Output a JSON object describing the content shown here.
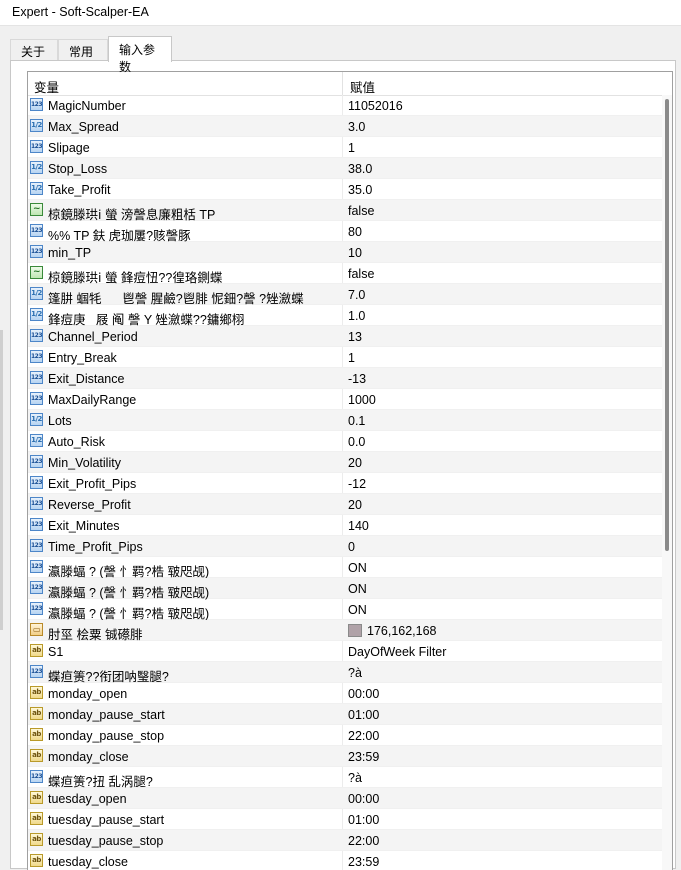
{
  "window": {
    "title": "Expert - Soft-Scalper-EA"
  },
  "tabs": [
    {
      "label": "关于"
    },
    {
      "label": "常用"
    },
    {
      "label": "输入参数"
    }
  ],
  "table": {
    "col_variable": "变量",
    "col_value": "赋值",
    "rows": [
      {
        "type": "int",
        "icon": "123",
        "name": "MagicNumber",
        "value": "11052016"
      },
      {
        "type": "double",
        "icon": "1/2",
        "name": "Max_Spread",
        "value": "3.0"
      },
      {
        "type": "int",
        "icon": "123",
        "name": "Slipage",
        "value": "1"
      },
      {
        "type": "double",
        "icon": "1/2",
        "name": "Stop_Loss",
        "value": "38.0"
      },
      {
        "type": "double",
        "icon": "1/2",
        "name": "Take_Profit",
        "value": "35.0"
      },
      {
        "type": "bool",
        "icon": "~",
        "name": "椋鏡滕珙ⅰ 螢 滂謦息廉粗栝 TP",
        "value": "false"
      },
      {
        "type": "int",
        "icon": "123",
        "name": "%% TP 鈇 虎珈屢?赅謦豚",
        "value": "80"
      },
      {
        "type": "int",
        "icon": "123",
        "name": "min_TP",
        "value": "10"
      },
      {
        "type": "bool",
        "icon": "~",
        "name": "椋鏡滕珙ⅰ 螢 鋒痘忸??徨珞鍘蝶",
        "value": "false"
      },
      {
        "type": "double",
        "icon": "1/2",
        "name": "篷肼 蝈牦      鬯謦 腥鹼?鬯腓 怩鈿?謦 ?矬瀲蝶",
        "value": "7.0"
      },
      {
        "type": "double",
        "icon": "1/2",
        "name": "鋒痘庚   屐 阄 謦 Y 矬瀲蝶??鏞鄉栩",
        "value": "1.0"
      },
      {
        "type": "int",
        "icon": "123",
        "name": "Channel_Period",
        "value": "13"
      },
      {
        "type": "int",
        "icon": "123",
        "name": "Entry_Break",
        "value": "1"
      },
      {
        "type": "int",
        "icon": "123",
        "name": "Exit_Distance",
        "value": "-13"
      },
      {
        "type": "int",
        "icon": "123",
        "name": "MaxDailyRange",
        "value": "1000"
      },
      {
        "type": "double",
        "icon": "1/2",
        "name": "Lots",
        "value": "0.1"
      },
      {
        "type": "double",
        "icon": "1/2",
        "name": "Auto_Risk",
        "value": "0.0"
      },
      {
        "type": "int",
        "icon": "123",
        "name": "Min_Volatility",
        "value": "20"
      },
      {
        "type": "int",
        "icon": "123",
        "name": "Exit_Profit_Pips",
        "value": "-12"
      },
      {
        "type": "int",
        "icon": "123",
        "name": "Reverse_Profit",
        "value": "20"
      },
      {
        "type": "int",
        "icon": "123",
        "name": "Exit_Minutes",
        "value": "140"
      },
      {
        "type": "int",
        "icon": "123",
        "name": "Time_Profit_Pips",
        "value": "0"
      },
      {
        "type": "int",
        "icon": "123",
        "name": "瀛滕蝠 ? (謦 忄羁?梏 皲咫觇)",
        "value": "ON"
      },
      {
        "type": "int",
        "icon": "123",
        "name": "瀛滕蝠 ? (謦 忄羁?梏 皲咫觇)",
        "value": "ON"
      },
      {
        "type": "int",
        "icon": "123",
        "name": "瀛滕蝠 ? (謦 忄羁?梏 皲咫觇)",
        "value": "ON"
      },
      {
        "type": "color",
        "icon": "▭",
        "name": "肘巠 桧粟 铖礤腓",
        "value": "176,162,168",
        "swatch": "#b0a2a8"
      },
      {
        "type": "string",
        "icon": "ab",
        "name": "S1",
        "value": "DayOfWeek Filter"
      },
      {
        "type": "int",
        "icon": "123",
        "name": "蝶疸箦??衔团呐瑿腿?",
        "value": "?à"
      },
      {
        "type": "string",
        "icon": "ab",
        "name": "monday_open",
        "value": "00:00"
      },
      {
        "type": "string",
        "icon": "ab",
        "name": "monday_pause_start",
        "value": "01:00"
      },
      {
        "type": "string",
        "icon": "ab",
        "name": "monday_pause_stop",
        "value": "22:00"
      },
      {
        "type": "string",
        "icon": "ab",
        "name": "monday_close",
        "value": "23:59"
      },
      {
        "type": "int",
        "icon": "123",
        "name": "蝶疸箦?扭 乱涡腿?",
        "value": "?à"
      },
      {
        "type": "string",
        "icon": "ab",
        "name": "tuesday_open",
        "value": "00:00"
      },
      {
        "type": "string",
        "icon": "ab",
        "name": "tuesday_pause_start",
        "value": "01:00"
      },
      {
        "type": "string",
        "icon": "ab",
        "name": "tuesday_pause_stop",
        "value": "22:00"
      },
      {
        "type": "string",
        "icon": "ab",
        "name": "tuesday_close",
        "value": "23:59"
      }
    ]
  }
}
